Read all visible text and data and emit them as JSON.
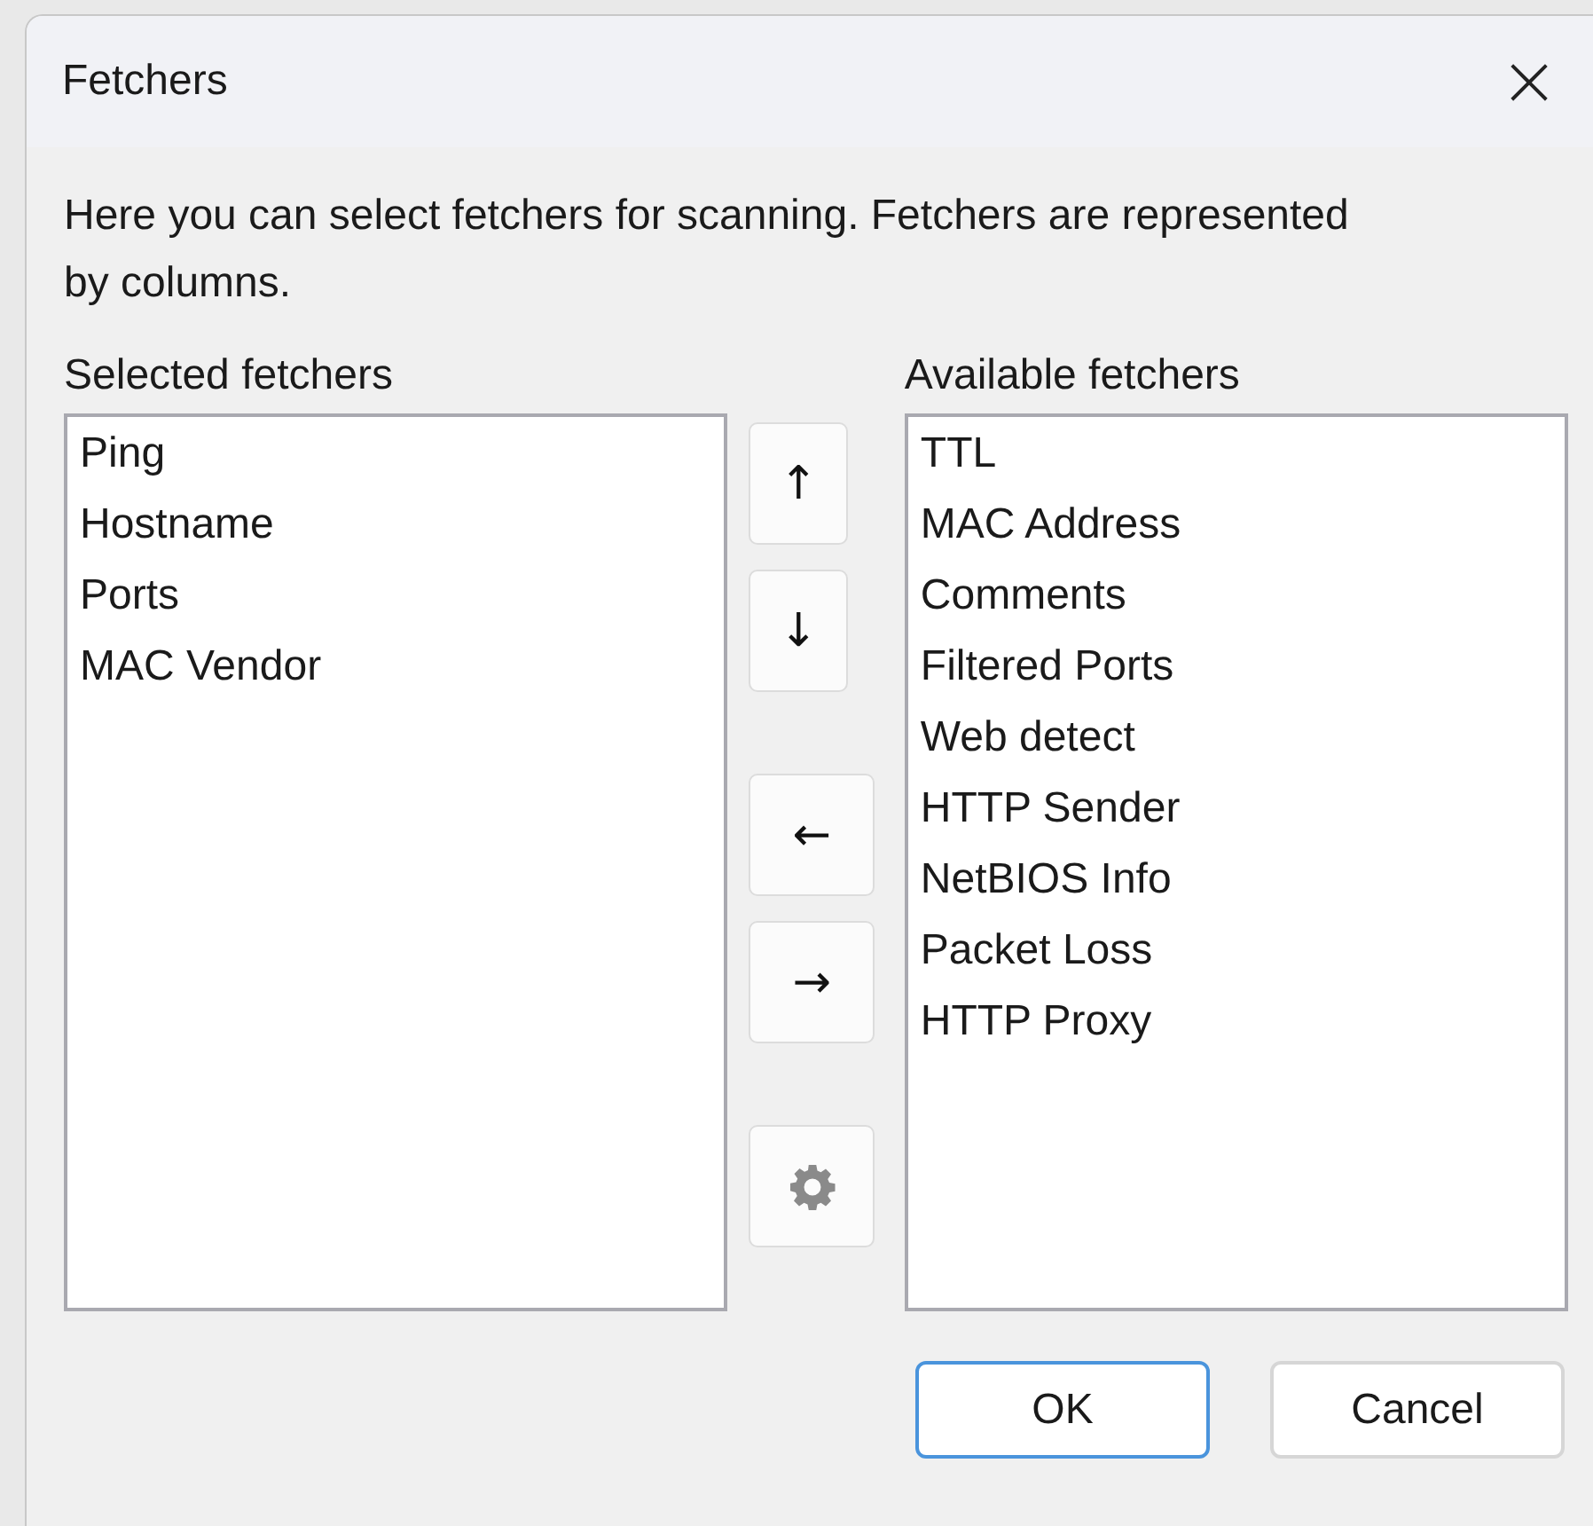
{
  "window": {
    "title": "Fetchers",
    "close": "×"
  },
  "description": "Here you can select fetchers for scanning. Fetchers are represented by columns.",
  "selected_list": {
    "label": "Selected fetchers",
    "items": [
      "Ping",
      "Hostname",
      "Ports",
      "MAC Vendor"
    ]
  },
  "move_button_groups": [
    [
      {
        "kind": "text",
        "label": "↑"
      },
      {
        "kind": "text",
        "label": "↓"
      }
    ],
    [
      {
        "kind": "text",
        "label": "←"
      },
      {
        "kind": "text",
        "label": "→"
      }
    ],
    [
      {
        "kind": "settings",
        "disabled": true
      }
    ]
  ],
  "available_list": {
    "label": "Available fetchers",
    "items": [
      "TTL",
      "MAC Address",
      "Comments",
      "Filtered Ports",
      "Web detect",
      "HTTP Sender",
      "NetBIOS Info",
      "Packet Loss",
      "HTTP Proxy"
    ]
  },
  "buttons": [
    {
      "label": "OK",
      "default": true
    },
    {
      "label": "Cancel",
      "default": false
    }
  ]
}
